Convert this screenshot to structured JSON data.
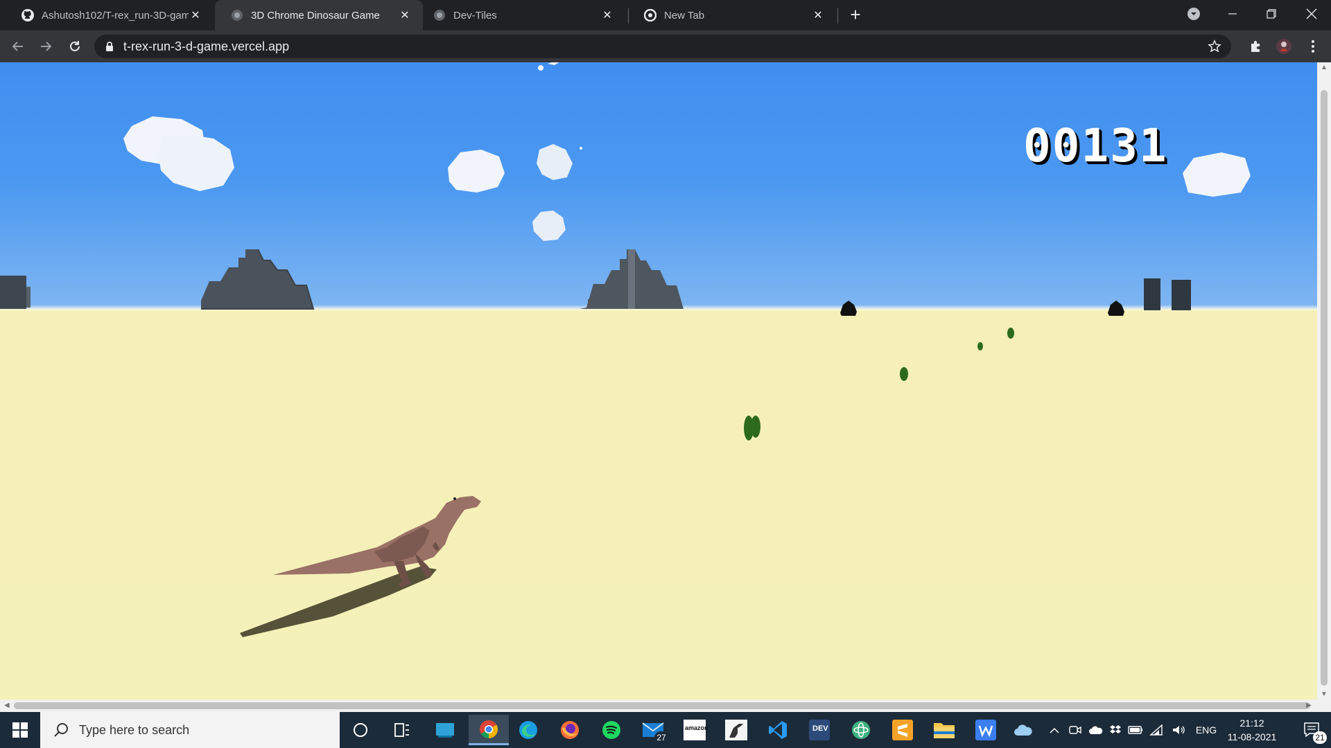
{
  "browser": {
    "tabs": [
      {
        "title": "Ashutosh102/T-rex_run-3D-game",
        "icon": "github-icon",
        "active": false
      },
      {
        "title": "3D Chrome Dinosaur Game",
        "icon": "globe-icon",
        "active": true
      },
      {
        "title": "Dev-Tiles",
        "icon": "globe-icon",
        "active": false
      },
      {
        "title": "New Tab",
        "icon": "chrome-icon",
        "active": false
      }
    ],
    "new_tab_label": "+",
    "close_glyph": "✕",
    "url": "t-rex-run-3-d-game.vercel.app"
  },
  "game": {
    "score": "00131"
  },
  "taskbar": {
    "search_placeholder": "Type here to search",
    "apps": [
      {
        "name": "cortana-icon"
      },
      {
        "name": "task-view-icon"
      },
      {
        "name": "desktop-app-icon"
      },
      {
        "name": "chrome-icon",
        "active": true
      },
      {
        "name": "edge-icon"
      },
      {
        "name": "firefox-icon"
      },
      {
        "name": "spotify-icon"
      },
      {
        "name": "mail-icon",
        "badge": "27"
      },
      {
        "name": "amazon-icon"
      },
      {
        "name": "dino-app-icon"
      },
      {
        "name": "vscode-icon"
      },
      {
        "name": "dev-icon"
      },
      {
        "name": "atom-icon"
      },
      {
        "name": "sublime-icon"
      },
      {
        "name": "file-explorer-icon"
      },
      {
        "name": "wps-icon"
      }
    ],
    "language": "ENG",
    "time": "21:12",
    "date": "11-08-2021",
    "notification_count": "21",
    "amazon_label": "amazon",
    "dev_label": "DEV"
  },
  "colors": {
    "sky": "#4a96f0",
    "sand": "#f4f0ba",
    "dino": "#9a7166"
  }
}
